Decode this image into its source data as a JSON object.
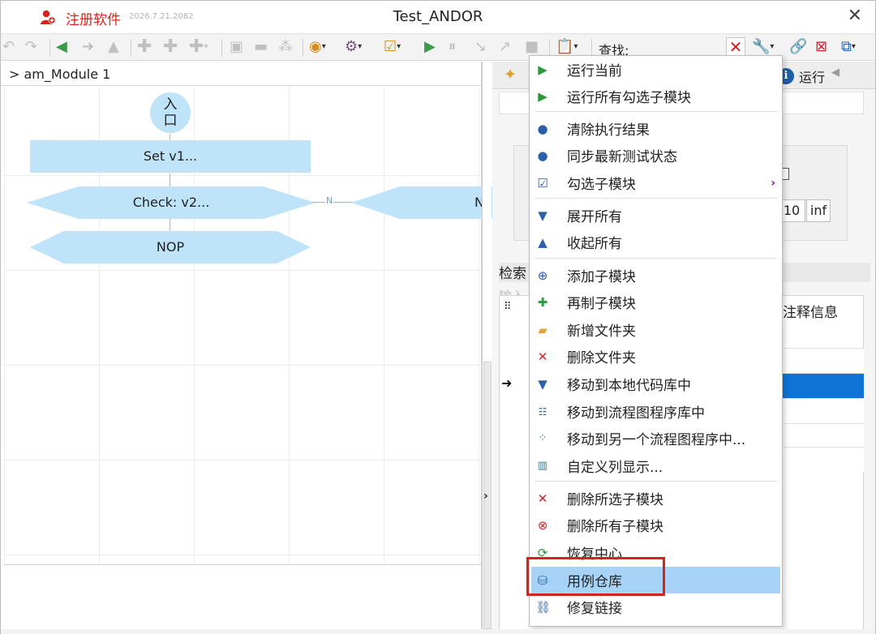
{
  "titlebar": {
    "register_label": "注册软件",
    "register_date": "2026.7.21.2082",
    "title": "Test_ANDOR",
    "close_glyph": "✕"
  },
  "toolbar": {
    "find_label": "查找:",
    "find_value": "",
    "clear_glyph": "✕",
    "icons": [
      "undo-icon",
      "redo-icon",
      "arrow-left-icon",
      "arrow-right-icon",
      "arrow-up-icon",
      "plus-icon",
      "plus-icon",
      "plus-dropdown-icon",
      "bold-icon",
      "minus-icon",
      "network-icon",
      "target-icon",
      "gear-icon",
      "checklist-icon",
      "run-icon",
      "pause-icon",
      "step-in-icon",
      "step-out-icon",
      "stop-icon",
      "clipboard-icon",
      "wrench-icon",
      "link-icon",
      "window-close-icon",
      "window-export-icon"
    ]
  },
  "left_pane": {
    "module_title": "> am_Module 1",
    "nodes": {
      "entry": "入\n口",
      "set": "Set v1...",
      "check": "Check: v2...",
      "check2": "N",
      "nop": "NOP",
      "connector_label": "N"
    }
  },
  "right_pane": {
    "tab_run_label": "运行",
    "tab_info_glyph": "i",
    "range_values": [
      "10",
      "inf"
    ],
    "search_label": "检索",
    "input_hint": "输入",
    "notes_column": "注释信息"
  },
  "context_menu": {
    "items": [
      {
        "label": "运行当前",
        "icon": "play-icon"
      },
      {
        "label": "运行所有勾选子模块",
        "icon": "play-icon"
      },
      {
        "label": "清除执行结果",
        "icon": "dot-icon"
      },
      {
        "label": "同步最新测试状态",
        "icon": "dot-icon"
      },
      {
        "label": "勾选子模块",
        "icon": "checkbox-icon",
        "submenu": "›"
      },
      {
        "label": "展开所有",
        "icon": "triangle-down-icon"
      },
      {
        "label": "收起所有",
        "icon": "triangle-up-icon"
      },
      {
        "label": "添加子模块",
        "icon": "add-circle-icon"
      },
      {
        "label": "再制子模块",
        "icon": "plus-icon"
      },
      {
        "label": "新增文件夹",
        "icon": "folder-icon"
      },
      {
        "label": "删除文件夹",
        "icon": "cross-icon"
      },
      {
        "label": "移动到本地代码库中",
        "icon": "triangle-down-icon"
      },
      {
        "label": "移动到流程图程序库中",
        "icon": "flowchart-icon"
      },
      {
        "label": "移动到另一个流程图程序中...",
        "icon": "share-icon"
      },
      {
        "label": "自定义列显示...",
        "icon": "columns-icon"
      },
      {
        "label": "删除所选子模块",
        "icon": "cross-icon"
      },
      {
        "label": "删除所有子模块",
        "icon": "delete-circle-icon"
      },
      {
        "label": "恢复中心",
        "icon": "refresh-icon"
      },
      {
        "label": "用例仓库",
        "icon": "database-icon"
      },
      {
        "label": "修复链接",
        "icon": "link-icon"
      }
    ]
  }
}
